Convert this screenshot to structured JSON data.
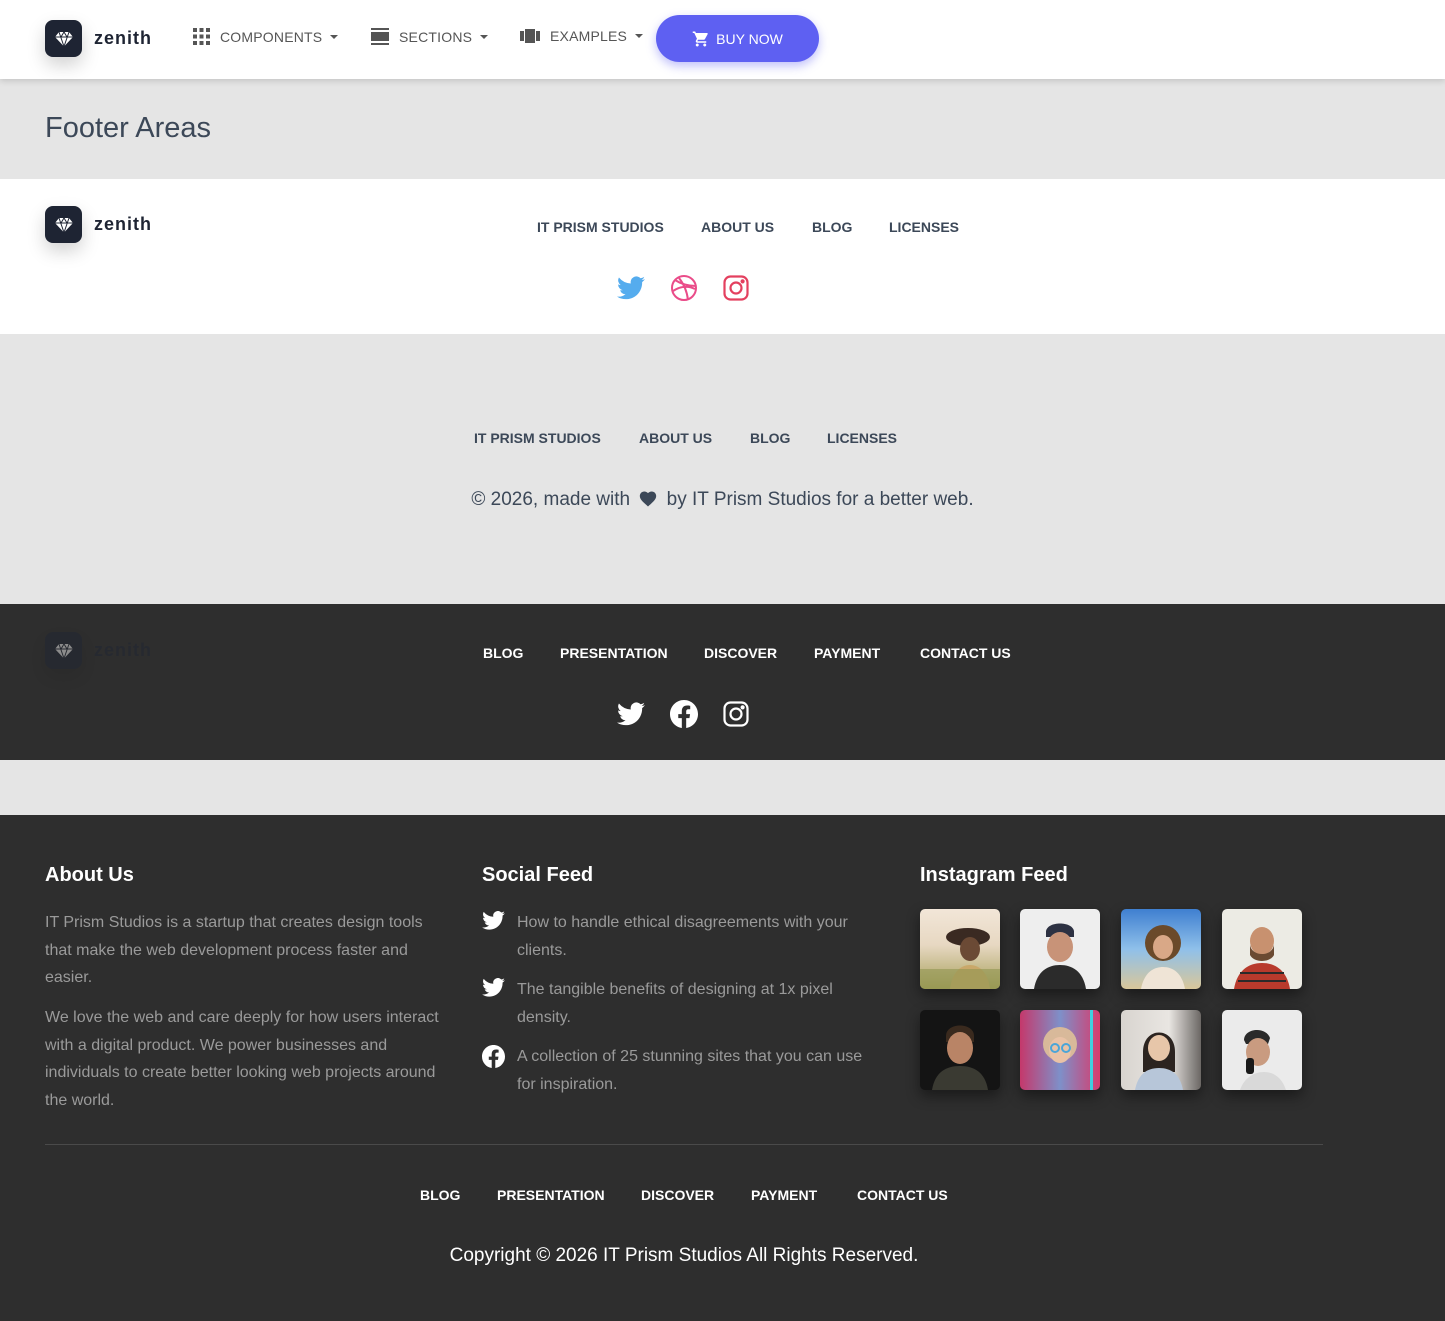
{
  "brand": {
    "name": "zenith"
  },
  "navbar": {
    "items": [
      {
        "label": "COMPONENTS",
        "icon": "apps-grid-icon"
      },
      {
        "label": "SECTIONS",
        "icon": "view-day-icon"
      },
      {
        "label": "EXAMPLES",
        "icon": "view-carousel-icon"
      }
    ],
    "buy_label": "BUY NOW",
    "buy_icon": "shopping-cart-icon",
    "buy_color": "#5e60f2"
  },
  "page": {
    "title": "Footer Areas"
  },
  "footer1": {
    "links": [
      "IT PRISM STUDIOS",
      "ABOUT US",
      "BLOG",
      "LICENSES"
    ],
    "social": [
      {
        "icon": "twitter-icon",
        "color": "#55acee"
      },
      {
        "icon": "dribbble-icon",
        "color": "#ea4c89"
      },
      {
        "icon": "instagram-icon",
        "color": "#e4405f"
      }
    ]
  },
  "footer2": {
    "links": [
      "IT PRISM STUDIOS",
      "ABOUT US",
      "BLOG",
      "LICENSES"
    ],
    "copyright_pre": "© 2026, made with",
    "copyright_icon": "heart-icon",
    "copyright_post": "by IT Prism Studios for a better web."
  },
  "footer3": {
    "links": [
      "BLOG",
      "PRESENTATION",
      "DISCOVER",
      "PAYMENT",
      "CONTACT US"
    ],
    "social": [
      {
        "icon": "twitter-icon"
      },
      {
        "icon": "facebook-icon"
      },
      {
        "icon": "instagram-icon"
      }
    ]
  },
  "footer4": {
    "about": {
      "title": "About Us",
      "p1": "IT Prism Studios is a startup that creates design tools that make the web development process faster and easier.",
      "p2": "We love the web and care deeply for how users interact with a digital product. We power businesses and individuals to create better looking web projects around the world."
    },
    "social_feed": {
      "title": "Social Feed",
      "items": [
        {
          "icon": "twitter-icon",
          "text": "How to handle ethical disagreements with your clients."
        },
        {
          "icon": "twitter-icon",
          "text": "The tangible benefits of designing at 1x pixel density."
        },
        {
          "icon": "facebook-icon",
          "text": "A collection of 25 stunning sites that you can use for inspiration."
        }
      ]
    },
    "instagram": {
      "title": "Instagram Feed",
      "photos": [
        "woman-hat-photo",
        "man-cap-photo",
        "woman-curly-hair-photo",
        "bearded-man-photo",
        "man-portrait-photo",
        "woman-glasses-photo",
        "asian-woman-photo",
        "man-phone-photo"
      ]
    },
    "links": [
      "BLOG",
      "PRESENTATION",
      "DISCOVER",
      "PAYMENT",
      "CONTACT US"
    ],
    "copyright": "Copyright © 2026 IT Prism Studios All Rights Reserved."
  }
}
